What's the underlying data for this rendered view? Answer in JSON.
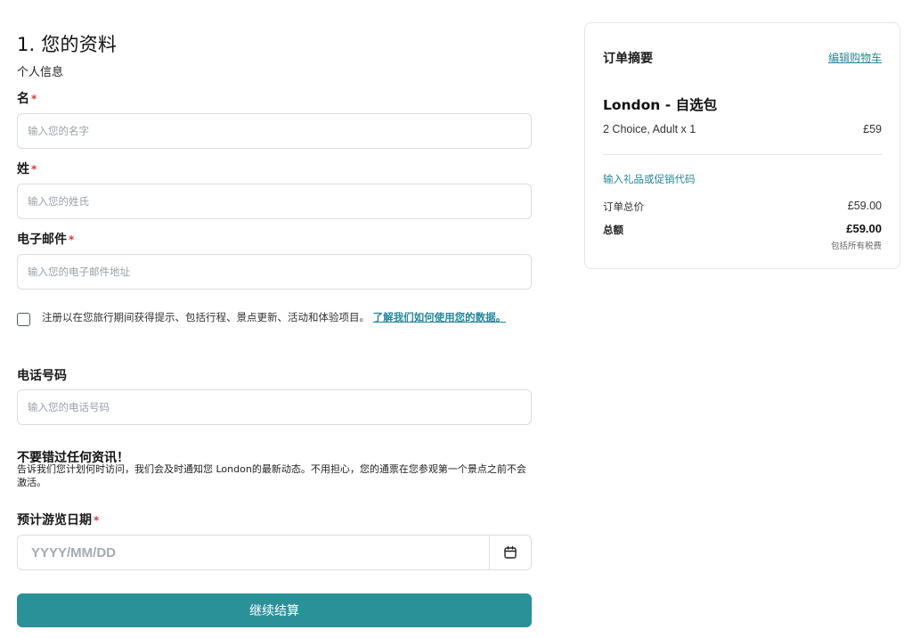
{
  "form": {
    "title": "1. 您的资料",
    "section": "个人信息",
    "first_name": {
      "label": "名",
      "required": "*",
      "placeholder": "输入您的名字",
      "value": ""
    },
    "last_name": {
      "label": "姓",
      "required": "*",
      "placeholder": "输入您的姓氏",
      "value": ""
    },
    "email": {
      "label": "电子邮件",
      "required": "*",
      "placeholder": "输入您的电子邮件地址",
      "value": ""
    },
    "consent": {
      "text": "注册以在您旅行期间获得提示、包括行程、景点更新、活动和体验项目。",
      "link": "了解我们如何使用您的数据。"
    },
    "phone": {
      "label": "电话号码",
      "placeholder": "输入您的电话号码",
      "value": ""
    },
    "info": {
      "title": "不要错过任何资讯！",
      "text": "告诉我们您计划何时访问，我们会及时通知您 London的最新动态。不用担心，您的通票在您参观第一个景点之前不会激活。"
    },
    "visit_date": {
      "label": "预计游览日期",
      "required": "*",
      "placeholder": "YYYY/MM/DD",
      "icon": "calendar-icon"
    },
    "continue_button": "继续结算"
  },
  "summary": {
    "title": "订单摘要",
    "edit_cart": "编辑购物车",
    "product": "London - 自选包",
    "item_desc": "2 Choice, Adult x 1",
    "item_price": "£59",
    "promo_link": "输入礼品或促销代码",
    "subtotal_label": "订单总价",
    "subtotal_value": "£59.00",
    "total_label": "总额",
    "total_value": "£59.00",
    "tax_note": "包括所有税费"
  },
  "colors": {
    "accent": "#2b9199",
    "link": "#24889a",
    "required": "#d23c3c",
    "border": "#d9dde3"
  }
}
